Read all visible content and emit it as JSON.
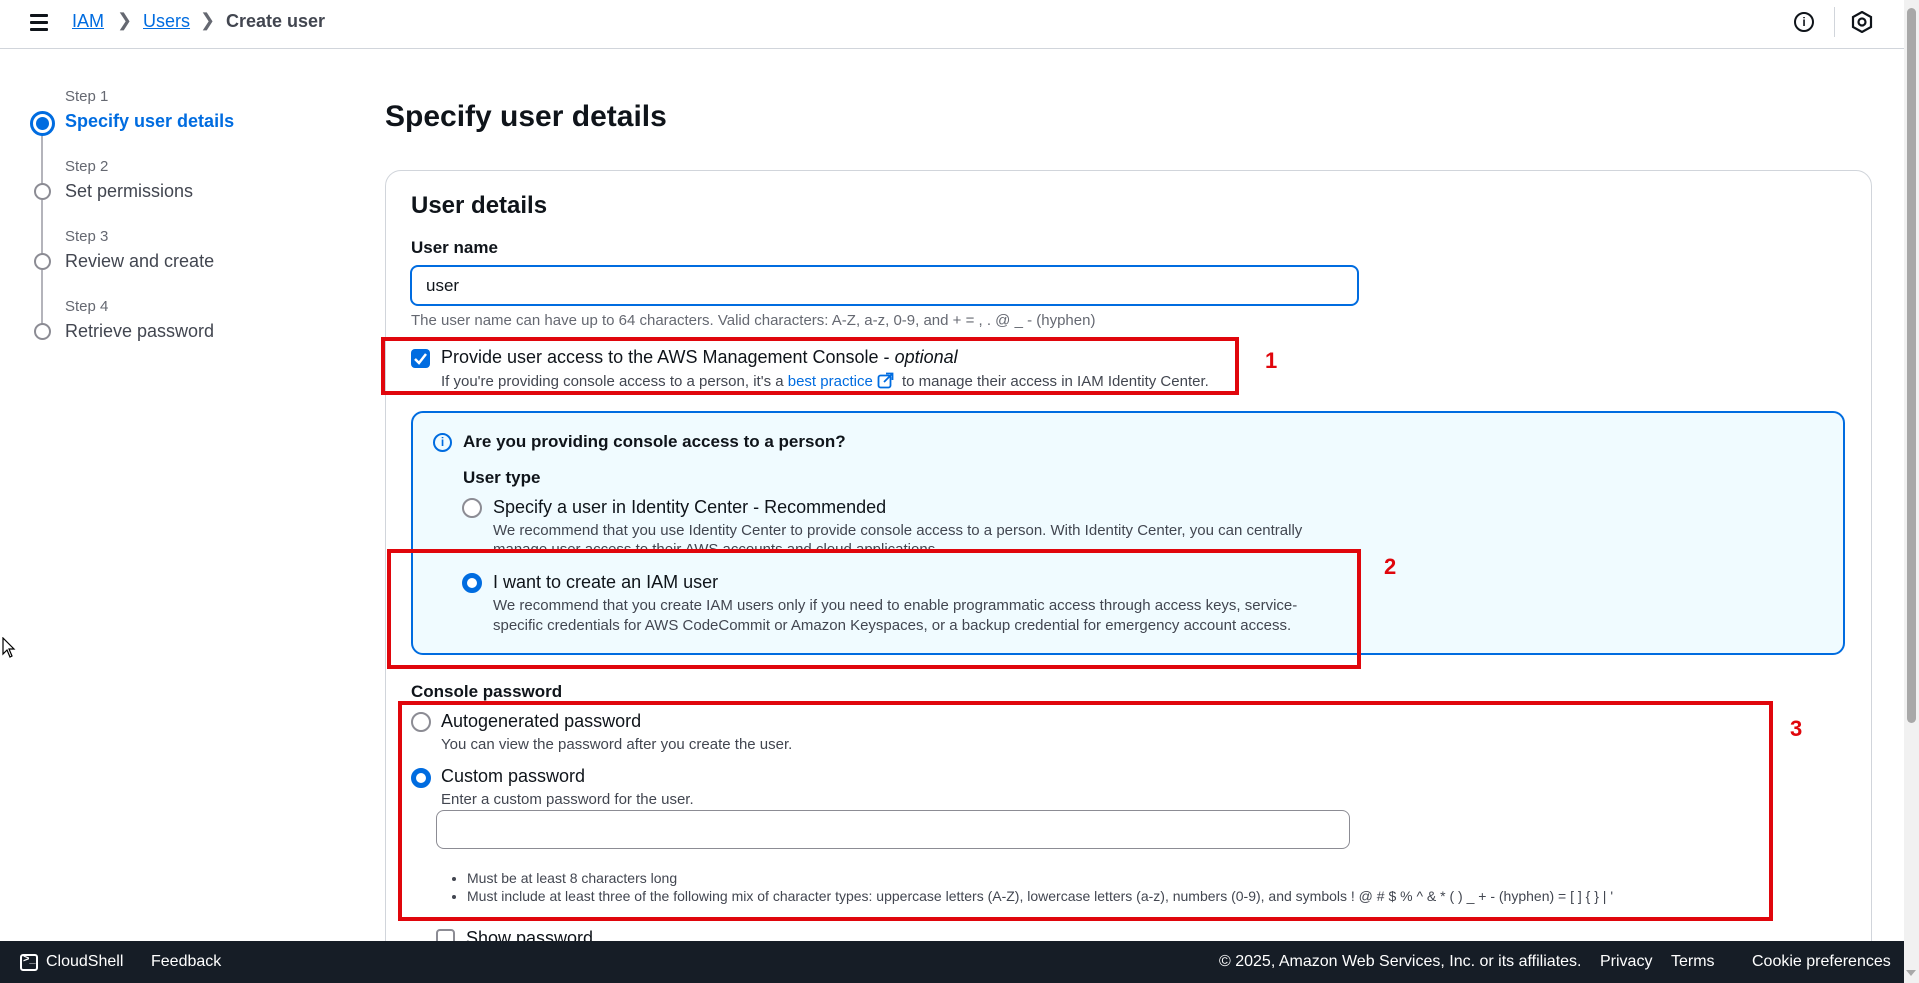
{
  "breadcrumbs": [
    {
      "label": "IAM"
    },
    {
      "label": "Users"
    },
    {
      "label": "Create user"
    }
  ],
  "steps": [
    {
      "num": "Step 1",
      "title": "Specify user details",
      "state": "active"
    },
    {
      "num": "Step 2",
      "title": "Set permissions",
      "state": "pending"
    },
    {
      "num": "Step 3",
      "title": "Review and create",
      "state": "pending"
    },
    {
      "num": "Step 4",
      "title": "Retrieve password",
      "state": "pending"
    }
  ],
  "page_title": "Specify user details",
  "user_details": {
    "title": "User details",
    "username_label": "User name",
    "username_value": "user",
    "username_hint": "The user name can have up to 64 characters. Valid characters: A-Z, a-z, 0-9, and + = , . @ _ - (hyphen)",
    "console_access": {
      "checked": true,
      "label": "Provide user access to the AWS Management Console - ",
      "label_optional": "optional",
      "desc_pre": "If you're providing console access to a person, it's a ",
      "desc_link": "best practice",
      "desc_post": " to manage their access in IAM Identity Center."
    }
  },
  "info_box": {
    "heading": "Are you providing console access to a person?",
    "user_type_label": "User type",
    "options": [
      {
        "label": "Specify a user in Identity Center - Recommended",
        "selected": false,
        "desc1": "We recommend that you use Identity Center to provide console access to a person. With Identity Center, you can centrally",
        "desc2": "manage user access to their AWS accounts and cloud applications."
      },
      {
        "label": "I want to create an IAM user",
        "selected": true,
        "desc1": "We recommend that you create IAM users only if you need to enable programmatic access through access keys, service-",
        "desc2": "specific credentials for AWS CodeCommit or Amazon Keyspaces, or a backup credential for emergency account access."
      }
    ]
  },
  "console_password": {
    "label": "Console password",
    "options": [
      {
        "label": "Autogenerated password",
        "desc": "You can view the password after you create the user.",
        "selected": false
      },
      {
        "label": "Custom password",
        "desc": "Enter a custom password for the user.",
        "selected": true
      }
    ],
    "input_value": "",
    "rules": [
      "Must be at least 8 characters long",
      "Must include at least three of the following mix of character types: uppercase letters (A-Z), lowercase letters (a-z), numbers (0-9), and symbols ! @ # $ % ^ & * ( ) _ + - (hyphen) = [ ] { } | '"
    ],
    "show_password_label": "Show password"
  },
  "annotations": [
    "1",
    "2",
    "3"
  ],
  "footer": {
    "cloudshell": "CloudShell",
    "feedback": "Feedback",
    "copyright": "© 2025, Amazon Web Services, Inc. or its affiliates.",
    "privacy": "Privacy",
    "terms": "Terms",
    "cookies": "Cookie preferences"
  },
  "colors": {
    "accent": "#006ce0",
    "annotation": "#e0060c",
    "info_bg": "#f0fbff",
    "footer_bg": "#161d26"
  }
}
